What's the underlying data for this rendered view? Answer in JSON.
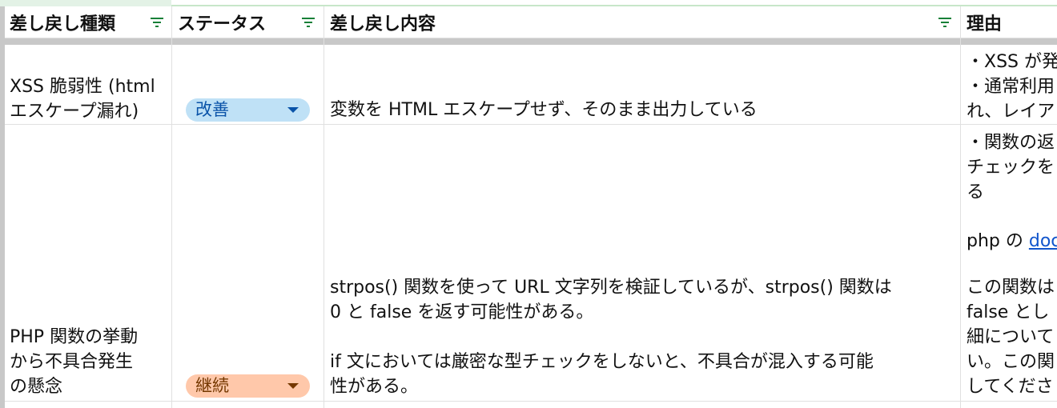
{
  "columns": [
    {
      "label": "差し戻し種類"
    },
    {
      "label": "ステータス"
    },
    {
      "label": "差し戻し内容"
    },
    {
      "label": "理由"
    }
  ],
  "rows": [
    {
      "type": "XSS 脆弱性 (html\nエスケープ漏れ)",
      "status": "改善",
      "content": "変数を HTML エスケープせず、そのまま出力している",
      "reason": "・XSS が発\n・通常利用\nれ、レイア"
    },
    {
      "type": "PHP 関数の挙動\nから不具合発生\nの懸念",
      "status": "継続",
      "content": "strpos() 関数を使って URL 文字列を検証しているが、strpos() 関数は\n0 と false を返す可能性がある。\n\nif 文においては厳密な型チェックをしないと、不具合が混入する可能\n性がある。",
      "reason_top": "・関数の返\nチェックを\nる",
      "reason_link_prefix": "php の ",
      "reason_link": "doc",
      "reason_bottom": "この関数は\nfalse とし\n細について\nい。この関\nしてくださ"
    }
  ],
  "colors": {
    "status_improve_bg": "#bfe1f6",
    "status_improve_text": "#0a53a8",
    "status_continue_bg": "#ffc8aa",
    "status_continue_text": "#753800",
    "filter_icon": "#188038"
  }
}
